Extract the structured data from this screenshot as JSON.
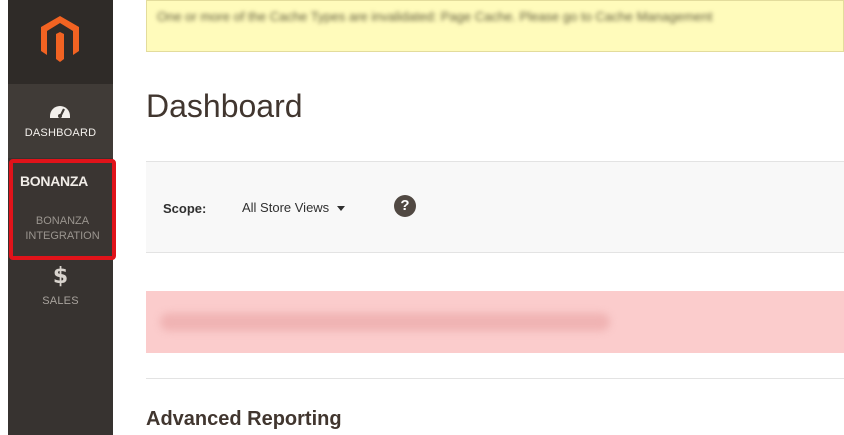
{
  "sidebar": {
    "logo_icon": "magento-logo-icon",
    "dashboard": {
      "label": "DASHBOARD",
      "icon": "speedometer-icon"
    },
    "bonanza": {
      "title": "BONANZA",
      "subtitle_line1": "BONANZA",
      "subtitle_line2": "INTEGRATION"
    },
    "sales": {
      "symbol": "$",
      "label": "SALES"
    }
  },
  "notice": {
    "text": "One or more of the Cache Types are invalidated: Page Cache. Please go to Cache Management"
  },
  "page": {
    "title": "Dashboard"
  },
  "scope": {
    "label": "Scope:",
    "value": "All Store Views",
    "help": "?"
  },
  "sections": {
    "advanced_reporting": "Advanced Reporting"
  },
  "colors": {
    "sidebar_bg": "#373330",
    "highlight": "#e0131a",
    "logo_orange": "#f26322",
    "notice_bg": "#fffbbb",
    "error_bg": "#fbcccc"
  }
}
